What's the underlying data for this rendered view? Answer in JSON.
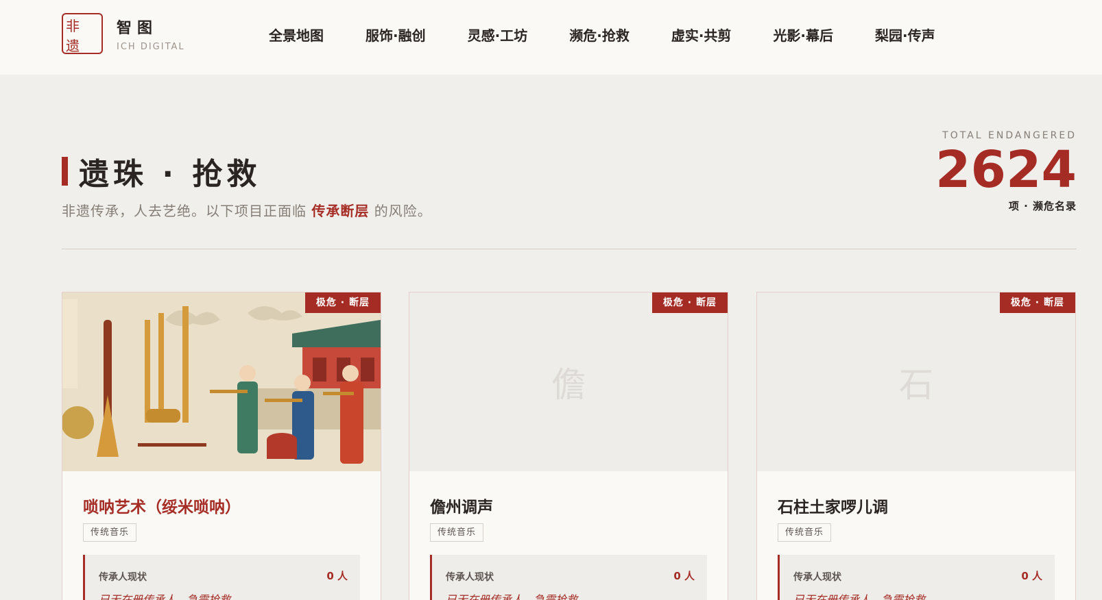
{
  "header": {
    "logo_chars": [
      "非",
      "遗"
    ],
    "brand_name": "智图",
    "brand_sub": "ICH DIGITAL",
    "nav": [
      {
        "label": "全景地图"
      },
      {
        "label": "服饰·融创"
      },
      {
        "label": "灵感·工坊"
      },
      {
        "label": "濒危·抢救"
      },
      {
        "label": "虚实·共剪"
      },
      {
        "label": "光影·幕后"
      },
      {
        "label": "梨园·传声"
      }
    ]
  },
  "hero": {
    "title": "遗珠 · 抢救",
    "subtitle_before": "非遗传承，人去艺绝。以下项目正面临 ",
    "subtitle_highlight": "传承断层",
    "subtitle_after": " 的风险。",
    "stat_label": "TOTAL ENDANGERED",
    "stat_value": "2624",
    "stat_unit": "项 · 濒危名录"
  },
  "cards": [
    {
      "badge": "极危 · 断层",
      "title": "唢呐艺术（绥米唢呐）",
      "tag": "传统音乐",
      "status_label": "传承人现状",
      "status_count": "0 人",
      "status_note": "已无在册传承人，急需抢救。",
      "image": "illustration-suona-ensemble"
    },
    {
      "badge": "极危 · 断层",
      "title": "儋州调声",
      "tag": "传统音乐",
      "status_label": "传承人现状",
      "status_count": "0 人",
      "status_note": "已无在册传承人，急需抢救。",
      "placeholder_glyph": "儋"
    },
    {
      "badge": "极危 · 断层",
      "title": "石柱土家啰儿调",
      "tag": "传统音乐",
      "status_label": "传承人现状",
      "status_count": "0 人",
      "status_note": "已无在册传承人，急需抢救。",
      "placeholder_glyph": "石"
    }
  ],
  "colors": {
    "accent": "#a52c24",
    "background": "#f1efeb",
    "header_bg": "#fbf9f6"
  }
}
